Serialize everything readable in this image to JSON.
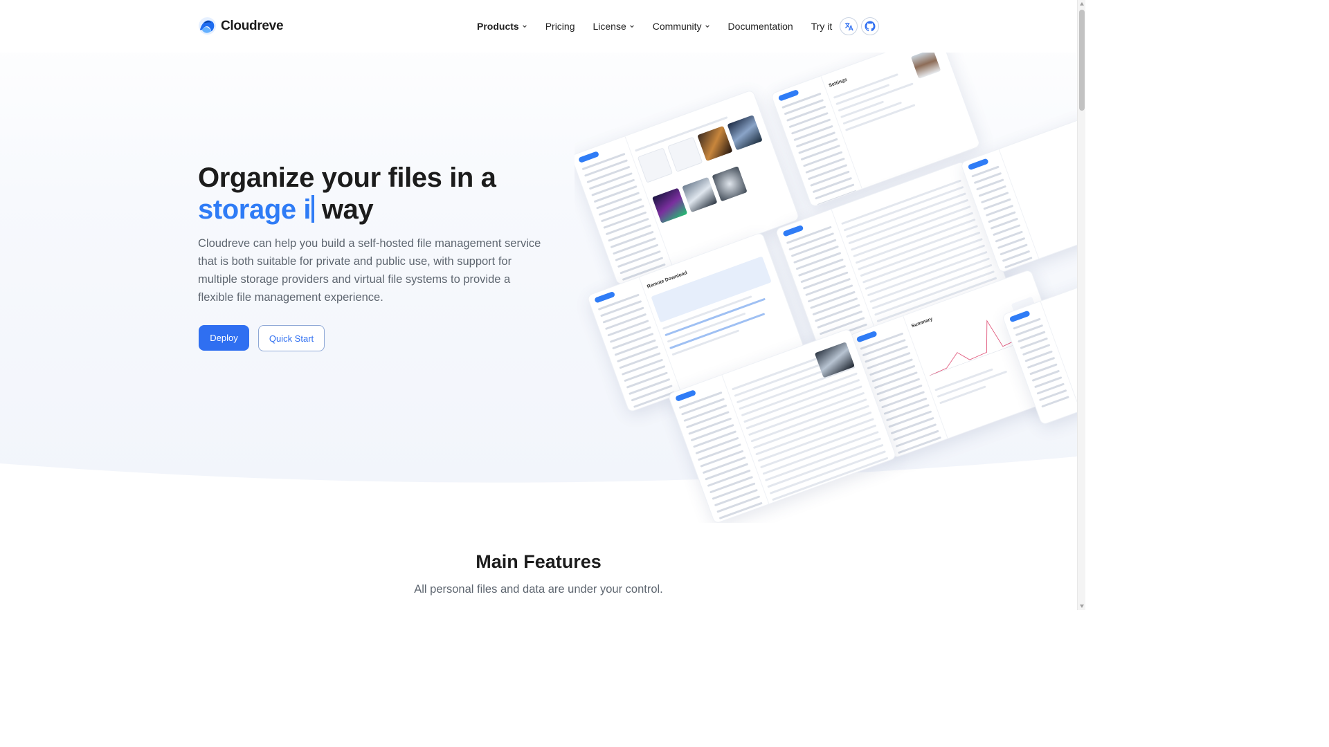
{
  "brand": {
    "name": "Cloudreve"
  },
  "nav": {
    "items": [
      {
        "label": "Products",
        "dropdown": true,
        "active": true
      },
      {
        "label": "Pricing",
        "dropdown": false
      },
      {
        "label": "License",
        "dropdown": true
      },
      {
        "label": "Community",
        "dropdown": true
      },
      {
        "label": "Documentation",
        "dropdown": false
      },
      {
        "label": "Try it",
        "dropdown": false
      }
    ],
    "icons": [
      "translate-icon",
      "github-icon"
    ]
  },
  "hero": {
    "headline_part1": "Organize your files in a",
    "headline_typed": "storage i",
    "headline_part2": "way",
    "subtitle": "Cloudreve can help you build a self-hosted file management service that is both suitable for private and public use, with support for multiple storage providers and virtual file systems to provide a flexible file management experience.",
    "deploy_label": "Deploy",
    "quickstart_label": "Quick Start"
  },
  "collage": {
    "titles": {
      "settings": "Settings",
      "remote": "Remote Download",
      "summary": "Summary"
    }
  },
  "features": {
    "title": "Main Features",
    "subtitle": "All personal files and data are under your control."
  },
  "colors": {
    "accent": "#2f6ff1",
    "typed": "#2f7cf6",
    "highlight": "#fbe9c7"
  }
}
